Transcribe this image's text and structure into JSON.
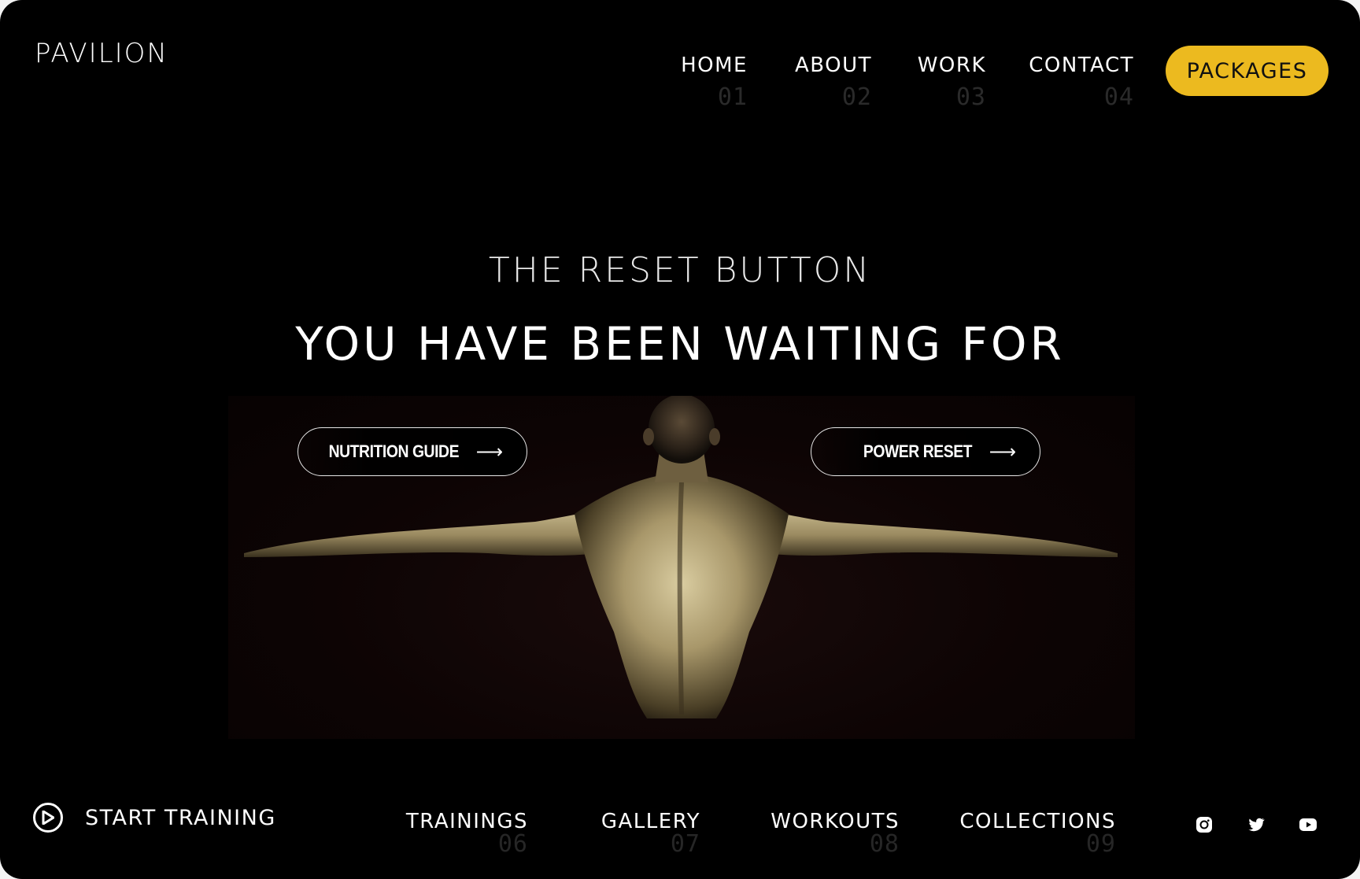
{
  "brand": {
    "logo": "PAVILION"
  },
  "nav": {
    "items": [
      {
        "label": "HOME",
        "num": "01"
      },
      {
        "label": "ABOUT",
        "num": "02"
      },
      {
        "label": "WORK",
        "num": "03"
      },
      {
        "label": "CONTACT",
        "num": "04"
      }
    ],
    "cta": "PACKAGES"
  },
  "hero": {
    "eyebrow": "THE RESET BUTTON",
    "headline": "YOU HAVE BEEN WAITING FOR",
    "buttons": [
      {
        "label": "NUTRITION GUIDE",
        "icon": "arrow-right-icon"
      },
      {
        "label": "POWER RESET",
        "icon": "arrow-right-icon"
      }
    ]
  },
  "footer": {
    "start": {
      "label": "START TRAINING",
      "icon": "play-circle-icon"
    },
    "items": [
      {
        "label": "TRAININGS",
        "num": "06"
      },
      {
        "label": "GALLERY",
        "num": "07"
      },
      {
        "label": "WORKOUTS",
        "num": "08"
      },
      {
        "label": "COLLECTIONS",
        "num": "09"
      }
    ],
    "social": [
      "instagram-icon",
      "twitter-icon",
      "youtube-icon"
    ]
  },
  "colors": {
    "accent": "#ecba1f",
    "background": "#000000",
    "text": "#ffffff",
    "muted_number": "#2a2a2a"
  }
}
